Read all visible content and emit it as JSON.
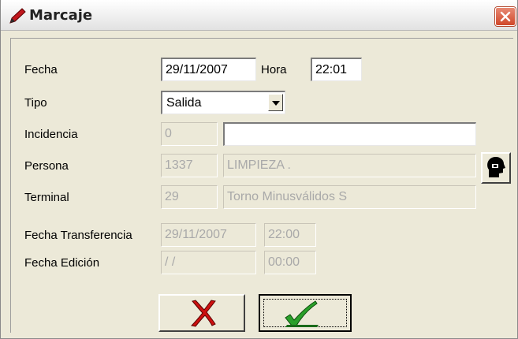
{
  "window": {
    "title": "Marcaje",
    "title_icon": "pencil-icon",
    "close_icon": "close-icon"
  },
  "form": {
    "fecha": {
      "label": "Fecha",
      "value": "29/11/2007"
    },
    "hora": {
      "label": "Hora",
      "value": "22:01"
    },
    "tipo": {
      "label": "Tipo",
      "selected": "Salida"
    },
    "incidencia": {
      "label": "Incidencia",
      "code": "0",
      "description": ""
    },
    "persona": {
      "label": "Persona",
      "code": "1337",
      "name": "LIMPIEZA .",
      "lookup_icon": "person-head-icon"
    },
    "terminal": {
      "label": "Terminal",
      "code": "29",
      "name": "Torno Minusválidos S"
    },
    "fecha_transferencia": {
      "label": "Fecha Transferencia",
      "date": "29/11/2007",
      "time": "22:00"
    },
    "fecha_edicion": {
      "label": "Fecha Edición",
      "date": " / /",
      "time": "00:00"
    }
  },
  "buttons": {
    "cancel_icon": "red-x-icon",
    "ok_icon": "green-check-icon"
  },
  "colors": {
    "window_bg": "#ece9d8",
    "close_red": "#d0472a",
    "cancel_red": "#cc1010",
    "ok_green": "#2aa02a"
  }
}
